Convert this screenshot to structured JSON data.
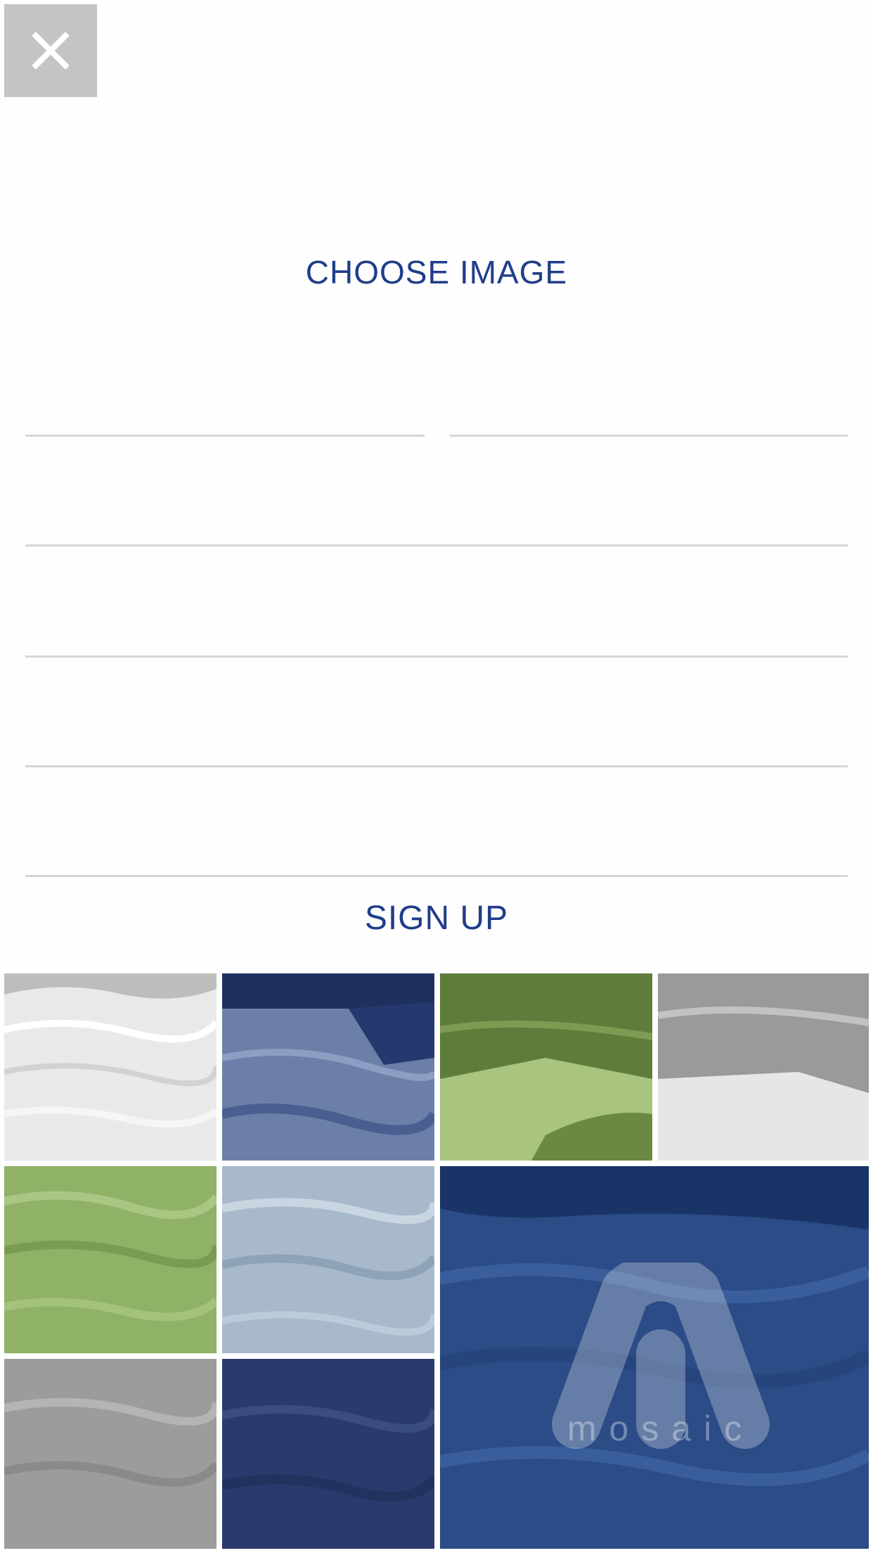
{
  "header": {
    "close_icon": "close-icon"
  },
  "profile": {
    "choose_image_label": "CHOOSE IMAGE"
  },
  "form": {
    "first_name": {
      "value": "",
      "placeholder": ""
    },
    "last_name": {
      "value": "",
      "placeholder": ""
    },
    "field_3": {
      "value": "",
      "placeholder": ""
    },
    "field_4": {
      "value": "",
      "placeholder": ""
    },
    "field_5": {
      "value": "",
      "placeholder": ""
    },
    "field_6": {
      "value": "",
      "placeholder": ""
    }
  },
  "actions": {
    "sign_up_label": "SIGN UP"
  },
  "brand": {
    "logo_text": "mosaic"
  },
  "colors": {
    "accent": "#1f3d8a",
    "close_bg": "#c4c4c4",
    "divider": "#d6d6d6",
    "tile_green": "#8fb267",
    "tile_navy": "#2c4a86",
    "tile_gray": "#9a9a9a"
  }
}
